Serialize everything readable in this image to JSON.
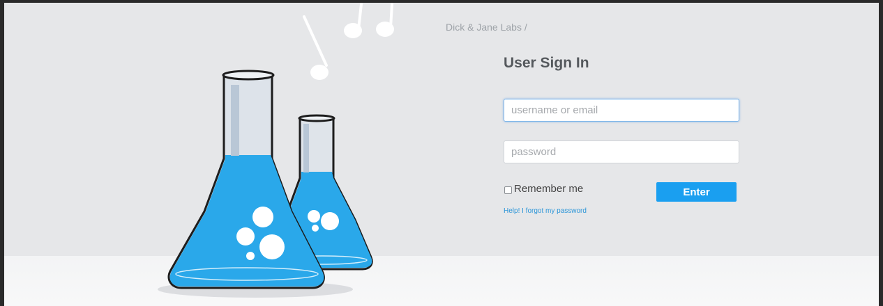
{
  "breadcrumb": "Dick & Jane Labs /",
  "signin": {
    "title": "User Sign In",
    "username_placeholder": "username or email",
    "password_placeholder": "password",
    "remember_label": "Remember me",
    "enter_label": "Enter",
    "help_link": "Help! I forgot my password"
  },
  "icons": {
    "illustration": "beakers-illustration",
    "notes": "music-notes"
  },
  "colors": {
    "background": "#e6e7e9",
    "button": "#1a9ff0",
    "liquid": "#2aa8ea",
    "link": "#2a95d8"
  }
}
